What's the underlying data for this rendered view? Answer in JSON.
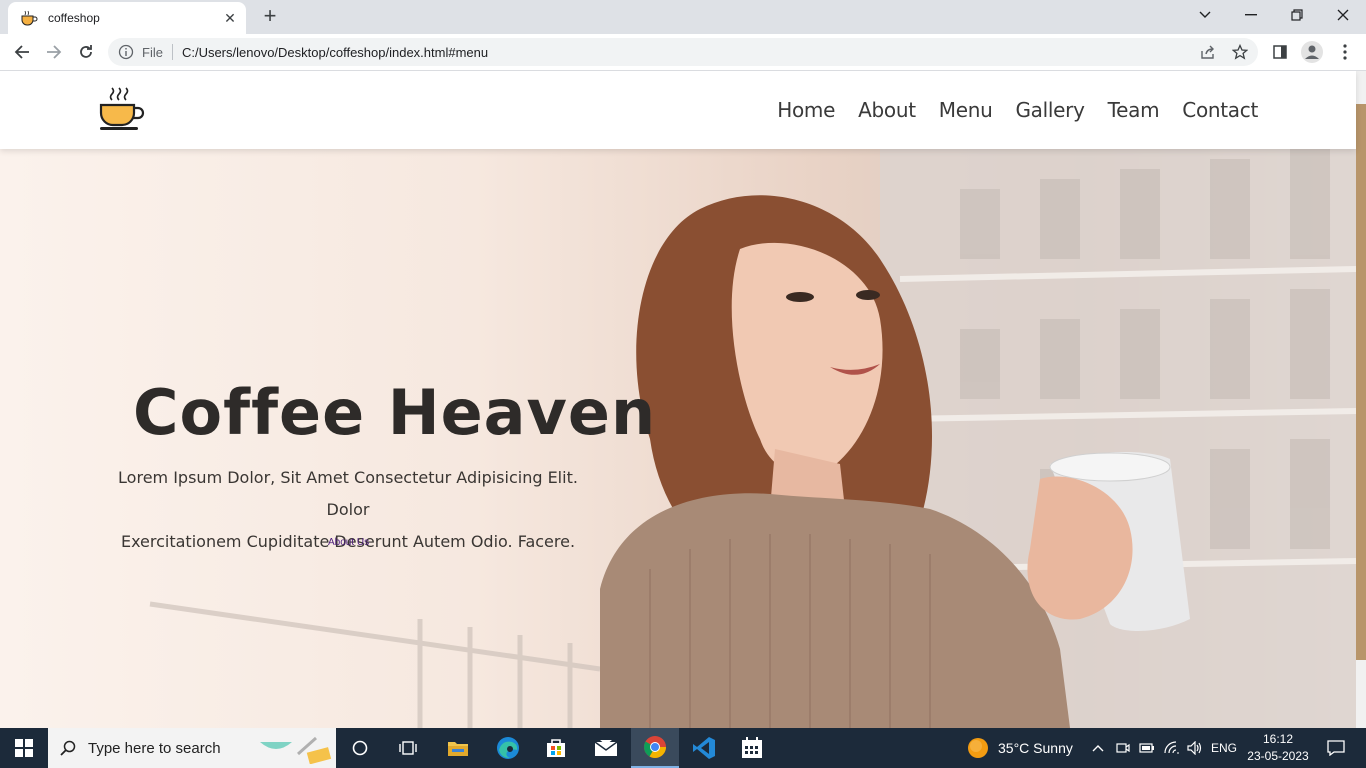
{
  "browser": {
    "tab_title": "coffeshop",
    "address_scheme_label": "File",
    "address_url": "C:/Users/lenovo/Desktop/coffeshop/index.html#menu"
  },
  "site": {
    "nav": [
      "Home",
      "About",
      "Menu",
      "Gallery",
      "Team",
      "Contact"
    ],
    "hero": {
      "title": "Coffee Heaven",
      "line1": "Lorem Ipsum Dolor, Sit Amet Consectetur Adipisicing Elit. Dolor",
      "line2": "Exercitationem Cupiditate Deserunt Autem Odio. Facere.",
      "link": "About Us"
    }
  },
  "taskbar": {
    "search_placeholder": "Type here to search",
    "weather": "35°C  Sunny",
    "language": "ENG",
    "time": "16:12",
    "date": "23-05-2023"
  },
  "colors": {
    "accent_scroll": "#b8956a",
    "taskbar_bg": "#1c2a3a"
  },
  "icons": [
    "coffee-cup-icon",
    "back-icon",
    "forward-icon",
    "reload-icon",
    "info-icon",
    "share-icon",
    "star-icon",
    "sidepanel-icon",
    "profile-icon",
    "kebab-icon",
    "windows-icon",
    "search-icon",
    "cortana-icon",
    "taskview-icon",
    "explorer-icon",
    "edge-icon",
    "store-icon",
    "mail-icon",
    "chrome-icon",
    "vscode-icon",
    "calendar-icon",
    "weather-icon",
    "network-icon",
    "volume-icon",
    "battery-icon",
    "notification-icon"
  ]
}
